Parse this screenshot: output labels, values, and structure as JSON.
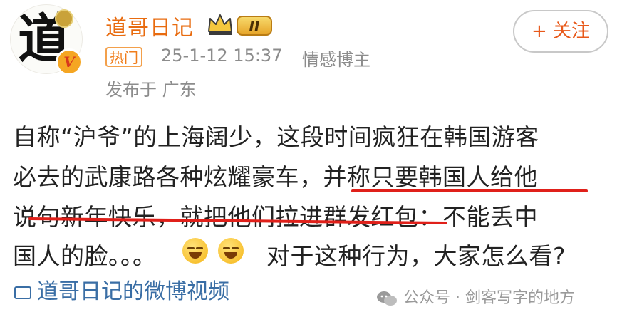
{
  "post": {
    "author": {
      "name": "道哥日记",
      "avatar_glyph": "道",
      "verified_badge": "V",
      "level_badge": "II"
    },
    "follow_label": "+ 关注",
    "hot_tag": "热门",
    "timestamp": "25-1-12 15:37",
    "category": "情感博主",
    "location": "发布于 广东",
    "lines": [
      "自称“沪爷”的上海阔少，这段时间疯狂在韩国游客",
      "必去的武康路各种炫耀豪车，并称只要韩国人给他",
      "说句新年快乐，就把他们拉进群发红包：不能丢中"
    ],
    "last_line_start": "国人的脸。。。",
    "last_line_end": "对于这种行为，大家怎么看?",
    "video_link": "道哥日记的微博视频",
    "watermark": "公众号 · 剑客写字的地方"
  },
  "colors": {
    "username": "#e86b0f",
    "follow": "#e8591a",
    "meta": "#8c8c8c",
    "underline": "#e0201a",
    "link": "#3a6ea5"
  },
  "icons": [
    "verified-icon",
    "crown-icon",
    "emoji-smirk-icon",
    "video-icon",
    "wechat-icon"
  ]
}
